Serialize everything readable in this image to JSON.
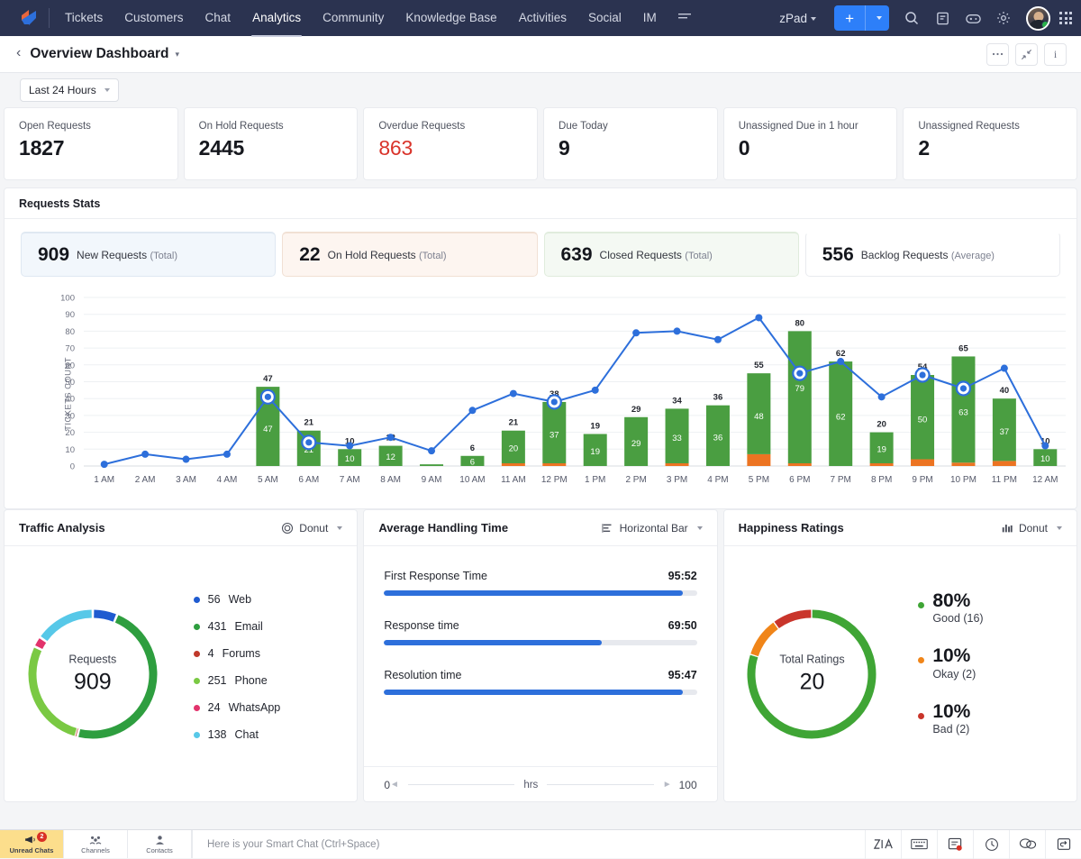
{
  "topnav": {
    "logo_name": "zoho-desk-logo",
    "items": [
      {
        "label": "Tickets",
        "active": false
      },
      {
        "label": "Customers",
        "active": false
      },
      {
        "label": "Chat",
        "active": false
      },
      {
        "label": "Analytics",
        "active": true
      },
      {
        "label": "Community",
        "active": false
      },
      {
        "label": "Knowledge Base",
        "active": false
      },
      {
        "label": "Activities",
        "active": false
      },
      {
        "label": "Social",
        "active": false
      },
      {
        "label": "IM",
        "active": false
      }
    ],
    "more_menu_label": "☰",
    "department": "zPad",
    "add_button_label": "+",
    "icons": [
      "search-icon",
      "notes-icon",
      "gamification-icon",
      "settings-gear-icon",
      "avatar",
      "apps-grid-icon"
    ]
  },
  "dashboard_header": {
    "back_label": "‹",
    "title": "Overview Dashboard",
    "buttons": [
      {
        "name": "more-options-button",
        "label": "•••"
      },
      {
        "name": "collapse-button",
        "label": "⤡"
      },
      {
        "name": "info-button",
        "label": "i"
      }
    ]
  },
  "filter": {
    "label": "Last 24 Hours"
  },
  "kpis": [
    {
      "label": "Open Requests",
      "value": "1827",
      "danger": false
    },
    {
      "label": "On Hold Requests",
      "value": "2445",
      "danger": false
    },
    {
      "label": "Overdue Requests",
      "value": "863",
      "danger": true
    },
    {
      "label": "Due Today",
      "value": "9",
      "danger": false
    },
    {
      "label": "Unassigned Due in 1 hour",
      "value": "0",
      "danger": false
    },
    {
      "label": "Unassigned Requests",
      "value": "2",
      "danger": false
    }
  ],
  "requests_stats": {
    "title": "Requests Stats",
    "summary": [
      {
        "num": "909",
        "text": "New Requests",
        "qualifier": "(Total)",
        "style": "blue"
      },
      {
        "num": "22",
        "text": "On Hold Requests",
        "qualifier": "(Total)",
        "style": "orange"
      },
      {
        "num": "639",
        "text": "Closed Requests",
        "qualifier": "(Total)",
        "style": "green"
      },
      {
        "num": "556",
        "text": "Backlog Requests",
        "qualifier": "(Average)",
        "style": "plain"
      }
    ]
  },
  "chart_data": {
    "type": "bar",
    "title": "Requests Stats",
    "xlabel": "",
    "ylabel": "TICKETS COUNT",
    "ylim": [
      0,
      100
    ],
    "yticks": [
      0,
      10,
      20,
      30,
      40,
      50,
      60,
      70,
      80,
      90,
      100
    ],
    "grid": true,
    "legend_position": "none",
    "categories": [
      "1 AM",
      "2 AM",
      "3 AM",
      "4 AM",
      "5 AM",
      "6 AM",
      "7 AM",
      "8 AM",
      "9 AM",
      "10 AM",
      "11 AM",
      "12 PM",
      "1 PM",
      "2 PM",
      "3 PM",
      "4 PM",
      "5 PM",
      "6 PM",
      "7 PM",
      "8 PM",
      "9 PM",
      "10 PM",
      "11 PM",
      "12 AM"
    ],
    "series": [
      {
        "name": "Closed",
        "type": "bar-segment",
        "color": "#4a9e41",
        "values": [
          0,
          0,
          0,
          0,
          47,
          21,
          10,
          12,
          1,
          6,
          20,
          37,
          19,
          29,
          33,
          36,
          48,
          79,
          62,
          19,
          50,
          63,
          37,
          10
        ]
      },
      {
        "name": "On Hold",
        "type": "bar-segment",
        "color": "#ec7422",
        "values": [
          0,
          0,
          0,
          0,
          0,
          0,
          0,
          0,
          0,
          0,
          1,
          1,
          0,
          0,
          1,
          0,
          7,
          1,
          0,
          1,
          4,
          2,
          3,
          0
        ]
      },
      {
        "name": "Total (bar top label)",
        "type": "bar-total",
        "color": "#222222",
        "values": [
          null,
          null,
          null,
          null,
          47,
          21,
          10,
          12,
          null,
          6,
          21,
          38,
          19,
          29,
          34,
          36,
          55,
          80,
          62,
          20,
          54,
          65,
          40,
          10
        ]
      },
      {
        "name": "New Requests",
        "type": "line",
        "color": "#2d6fdb",
        "values": [
          1,
          7,
          4,
          7,
          41,
          14,
          12,
          17,
          9,
          33,
          43,
          38,
          45,
          79,
          80,
          75,
          88,
          55,
          62,
          41,
          54,
          46,
          58,
          12
        ]
      }
    ],
    "line_markers_highlighted": [
      "5 AM",
      "6 AM",
      "12 PM",
      "6 PM",
      "9 PM",
      "10 PM"
    ]
  },
  "traffic_analysis": {
    "title": "Traffic Analysis",
    "chart_type": "Donut",
    "chart_type_icon": "donut-icon",
    "center_label": "Requests",
    "center_value": "909",
    "chart_data": {
      "type": "pie",
      "title": "Traffic Analysis",
      "categories": [
        "Web",
        "Email",
        "Forums",
        "Phone",
        "WhatsApp",
        "Chat"
      ],
      "values": [
        56,
        431,
        4,
        251,
        24,
        138
      ],
      "colors": [
        "#1f5bd0",
        "#2e9e3f",
        "#c0392b",
        "#7ac943",
        "#e2336c",
        "#57c8e8"
      ],
      "total": 909
    },
    "legend": [
      {
        "value": "56",
        "label": "Web",
        "color": "#1f5bd0"
      },
      {
        "value": "431",
        "label": "Email",
        "color": "#2e9e3f"
      },
      {
        "value": "4",
        "label": "Forums",
        "color": "#c0392b"
      },
      {
        "value": "251",
        "label": "Phone",
        "color": "#7ac943"
      },
      {
        "value": "24",
        "label": "WhatsApp",
        "color": "#e2336c"
      },
      {
        "value": "138",
        "label": "Chat",
        "color": "#57c8e8"
      }
    ]
  },
  "average_handling_time": {
    "title": "Average Handling Time",
    "chart_type": "Horizontal Bar",
    "chart_type_icon": "horizontal-bar-icon",
    "chart_data": {
      "type": "bar",
      "title": "Average Handling Time",
      "categories": [
        "First Response Time",
        "Response time",
        "Resolution time"
      ],
      "values": [
        95.52,
        69.5,
        95.47
      ],
      "value_labels": [
        "95:52",
        "69:50",
        "95:47"
      ],
      "xlabel": "hrs",
      "xlim": [
        0,
        100
      ]
    },
    "items": [
      {
        "name": "First Response Time",
        "value": "95:52",
        "pct": 95.52
      },
      {
        "name": "Response time",
        "value": "69:50",
        "pct": 69.5
      },
      {
        "name": "Resolution time",
        "value": "95:47",
        "pct": 95.47
      }
    ],
    "axis": {
      "min": "0",
      "unit": "hrs",
      "max": "100"
    }
  },
  "happiness_ratings": {
    "title": "Happiness Ratings",
    "chart_type": "Donut",
    "chart_type_icon": "bar-chart-icon",
    "center_label": "Total Ratings",
    "center_value": "20",
    "chart_data": {
      "type": "pie",
      "title": "Happiness Ratings",
      "categories": [
        "Good",
        "Okay",
        "Bad"
      ],
      "values": [
        16,
        2,
        2
      ],
      "percentages": [
        80,
        10,
        10
      ],
      "colors": [
        "#3fa535",
        "#f08519",
        "#c9352b"
      ],
      "total": 20
    },
    "legend": [
      {
        "pct": "80%",
        "sub": "Good (16)",
        "color": "#3fa535"
      },
      {
        "pct": "10%",
        "sub": "Okay (2)",
        "color": "#f08519"
      },
      {
        "pct": "10%",
        "sub": "Bad (2)",
        "color": "#c9352b"
      }
    ]
  },
  "taskbar": {
    "tabs": [
      {
        "label": "Unread Chats",
        "icon": "megaphone-icon",
        "badge": "2",
        "highlighted": true
      },
      {
        "label": "Channels",
        "icon": "channels-icon",
        "badge": "",
        "highlighted": false
      },
      {
        "label": "Contacts",
        "icon": "contacts-icon",
        "badge": "",
        "highlighted": false
      }
    ],
    "search_placeholder": "Here is your Smart Chat (Ctrl+Space)",
    "right_icons": [
      "zia-icon",
      "keyboard-icon",
      "tasks-icon",
      "clock-icon",
      "chat-icon",
      "undo-icon"
    ]
  }
}
